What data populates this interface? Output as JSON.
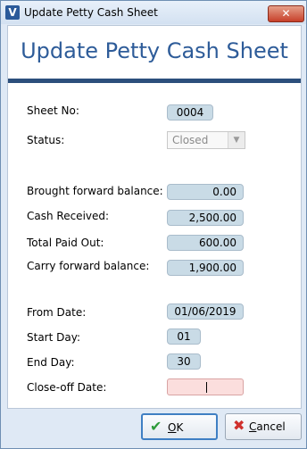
{
  "window": {
    "title": "Update Petty Cash Sheet",
    "close_label": "✕"
  },
  "header": {
    "title": "Update Petty Cash Sheet"
  },
  "form": {
    "sheet_no": {
      "label": "Sheet No:",
      "value": "0004"
    },
    "status": {
      "label": "Status:",
      "value": "Closed"
    },
    "brought_forward": {
      "label": "Brought forward balance:",
      "value": "0.00"
    },
    "cash_received": {
      "label": "Cash Received:",
      "value": "2,500.00"
    },
    "total_paid_out": {
      "label": "Total Paid Out:",
      "value": "600.00"
    },
    "carry_forward": {
      "label": "Carry forward balance:",
      "value": "1,900.00"
    },
    "from_date": {
      "label": "From Date:",
      "value": "01/06/2019"
    },
    "start_day": {
      "label": "Start Day:",
      "value": "01"
    },
    "end_day": {
      "label": "End Day:",
      "value": "30"
    },
    "close_off_date": {
      "label": "Close-off Date:",
      "value": ""
    }
  },
  "buttons": {
    "ok_mnemonic": "O",
    "ok_rest": "K",
    "cancel_mnemonic": "C",
    "cancel_rest": "ancel"
  },
  "icons": {
    "app": "app-icon",
    "ok": "checkmark-icon",
    "cancel": "x-icon"
  },
  "colors": {
    "accent": "#2e5c99",
    "header_rule": "#2c4f7c",
    "field_bg": "#c9dbe6",
    "error_field_bg": "#fbdedd"
  }
}
